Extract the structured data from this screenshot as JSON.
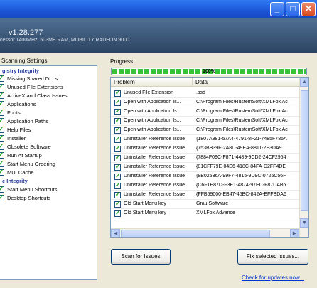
{
  "window": {
    "minimize_glyph": "_",
    "maximize_glyph": "□",
    "close_glyph": "✕"
  },
  "header": {
    "version": "v1.28.277",
    "sysinfo": "cessor 1400MHz, 503MB RAM, MOBILITY RADEON 9000"
  },
  "settings": {
    "title": "Scanning Settings",
    "categories": [
      {
        "label": "gistry Integrity"
      },
      {
        "label": "e Integrity"
      }
    ],
    "items": [
      {
        "label": "Missing Shared DLLs"
      },
      {
        "label": "Unused File Extensions"
      },
      {
        "label": "ActiveX and Class Issues"
      },
      {
        "label": "Applications"
      },
      {
        "label": "Fonts"
      },
      {
        "label": "Application Paths"
      },
      {
        "label": "Help Files"
      },
      {
        "label": "Installer"
      },
      {
        "label": "Obsolete Software"
      },
      {
        "label": "Run At Startup"
      },
      {
        "label": "Start Menu Ordering"
      },
      {
        "label": "MUI Cache"
      },
      {
        "label": "Start Menu Shortcuts"
      },
      {
        "label": "Desktop Shortcuts"
      }
    ]
  },
  "progress": {
    "title": "Progress",
    "percent_label": "100%",
    "value": 1.0
  },
  "table": {
    "headers": {
      "problem": "Problem",
      "data": "Data"
    },
    "rows": [
      {
        "problem": "Unused File Extension",
        "data": ".ssd"
      },
      {
        "problem": "Open with Application Is...",
        "data": "C:\\Program Files\\RustemSoft\\XMLFox Ac"
      },
      {
        "problem": "Open with Application Is...",
        "data": "C:\\Program Files\\RustemSoft\\XMLFox Ac"
      },
      {
        "problem": "Open with Application Is...",
        "data": "C:\\Program Files\\RustemSoft\\XMLFox Ac"
      },
      {
        "problem": "Open with Application Is...",
        "data": "C:\\Program Files\\RustemSoft\\XMLFox Ac"
      },
      {
        "problem": "Uninstaller Reference Issue",
        "data": "{1807A881-57A4-4791-8F21-7485F785A"
      },
      {
        "problem": "Uninstaller Reference Issue",
        "data": "{753BB39F-2A8D-49EA-8811-2E3DA9"
      },
      {
        "problem": "Uninstaller Reference Issue",
        "data": "{7884F09C-F871-4489-9CD2-24CF2954"
      },
      {
        "problem": "Uninstaller Reference Issue",
        "data": "{81CFF79E-04E6-418C-84FA-D2FF4DE"
      },
      {
        "problem": "Uninstaller Reference Issue",
        "data": "{8B02536A-99F7-4815-9D9C-0725C56F"
      },
      {
        "problem": "Uninstaller Reference Issue",
        "data": "{C6F1E87D-F3E1-4874-97EC-F87DAB6"
      },
      {
        "problem": "Uninstaller Reference Issue",
        "data": "{FFB59000-EB47-45BC-842A-EFFBDA6"
      },
      {
        "problem": "Old Start Menu key",
        "data": "Grau Software"
      },
      {
        "problem": "Old Start Menu key",
        "data": "XMLFox Advance"
      }
    ]
  },
  "scroll": {
    "up": "▲",
    "down": "▼",
    "left": "◀",
    "right": "▶"
  },
  "buttons": {
    "scan": "Scan for Issues",
    "fix": "Fix selected issues..."
  },
  "footer": {
    "update_link": "Check for updates now..."
  }
}
